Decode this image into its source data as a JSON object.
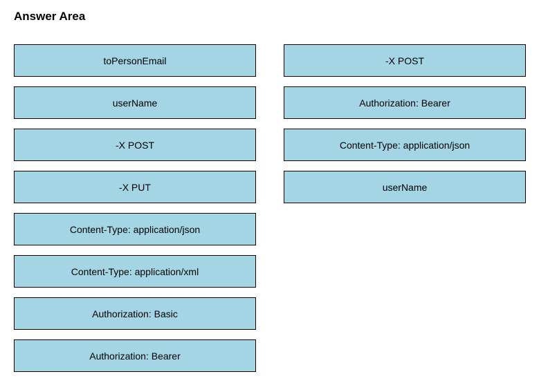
{
  "title": "Answer Area",
  "leftColumn": {
    "items": [
      {
        "label": "toPersonEmail"
      },
      {
        "label": "userName"
      },
      {
        "label": "-X POST"
      },
      {
        "label": "-X PUT"
      },
      {
        "label": "Content-Type: application/json"
      },
      {
        "label": "Content-Type: application/xml"
      },
      {
        "label": "Authorization: Basic"
      },
      {
        "label": "Authorization: Bearer"
      }
    ]
  },
  "rightColumn": {
    "items": [
      {
        "label": "-X POST"
      },
      {
        "label": "Authorization: Bearer"
      },
      {
        "label": "Content-Type: application/json"
      },
      {
        "label": "userName"
      }
    ]
  }
}
